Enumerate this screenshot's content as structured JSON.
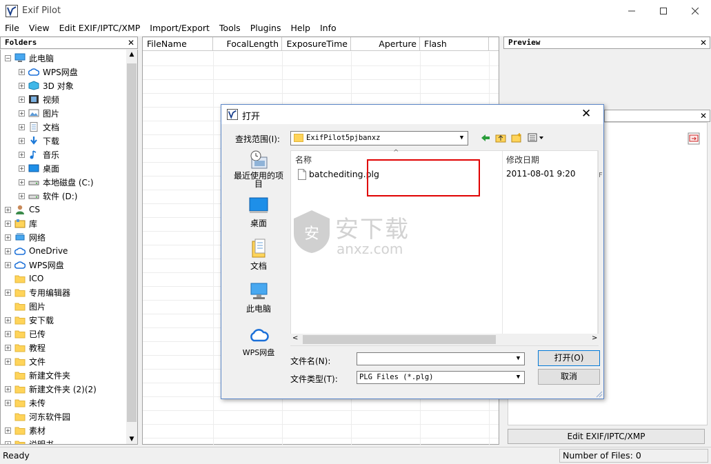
{
  "app": {
    "title": "Exif Pilot"
  },
  "menu": [
    "File",
    "View",
    "Edit EXIF/IPTC/XMP",
    "Import/Export",
    "Tools",
    "Plugins",
    "Help",
    "Info"
  ],
  "folders_pane": {
    "title": "Folders",
    "tree": [
      {
        "label": "此电脑",
        "level": 0,
        "expander": "−",
        "icon": "computer-icon"
      },
      {
        "label": "WPS网盘",
        "level": 1,
        "expander": "+",
        "icon": "cloud-icon"
      },
      {
        "label": "3D 对象",
        "level": 1,
        "expander": "+",
        "icon": "cube-icon"
      },
      {
        "label": "视频",
        "level": 1,
        "expander": "+",
        "icon": "video-icon"
      },
      {
        "label": "图片",
        "level": 1,
        "expander": "+",
        "icon": "picture-icon"
      },
      {
        "label": "文档",
        "level": 1,
        "expander": "+",
        "icon": "document-icon"
      },
      {
        "label": "下载",
        "level": 1,
        "expander": "+",
        "icon": "download-icon"
      },
      {
        "label": "音乐",
        "level": 1,
        "expander": "+",
        "icon": "music-icon"
      },
      {
        "label": "桌面",
        "level": 1,
        "expander": "+",
        "icon": "desktop-icon"
      },
      {
        "label": "本地磁盘 (C:)",
        "level": 1,
        "expander": "+",
        "icon": "drive-icon"
      },
      {
        "label": "软件 (D:)",
        "level": 1,
        "expander": "+",
        "icon": "drive-icon"
      },
      {
        "label": "CS",
        "level": 0,
        "expander": "+",
        "icon": "user-icon"
      },
      {
        "label": "库",
        "level": 0,
        "expander": "+",
        "icon": "library-icon"
      },
      {
        "label": "网络",
        "level": 0,
        "expander": "+",
        "icon": "network-icon"
      },
      {
        "label": "OneDrive",
        "level": 0,
        "expander": "+",
        "icon": "cloud-icon"
      },
      {
        "label": "WPS网盘",
        "level": 0,
        "expander": "+",
        "icon": "cloud-icon"
      },
      {
        "label": "ICO",
        "level": 0,
        "expander": "",
        "icon": "folder-icon"
      },
      {
        "label": "专用编辑器",
        "level": 0,
        "expander": "+",
        "icon": "folder-icon"
      },
      {
        "label": "图片",
        "level": 0,
        "expander": "",
        "icon": "folder-icon"
      },
      {
        "label": "安下载",
        "level": 0,
        "expander": "+",
        "icon": "folder-icon"
      },
      {
        "label": "已传",
        "level": 0,
        "expander": "+",
        "icon": "folder-icon"
      },
      {
        "label": "教程",
        "level": 0,
        "expander": "+",
        "icon": "folder-icon"
      },
      {
        "label": "文件",
        "level": 0,
        "expander": "+",
        "icon": "folder-icon"
      },
      {
        "label": "新建文件夹",
        "level": 0,
        "expander": "",
        "icon": "folder-icon"
      },
      {
        "label": "新建文件夹 (2)(2)",
        "level": 0,
        "expander": "+",
        "icon": "folder-icon"
      },
      {
        "label": "未传",
        "level": 0,
        "expander": "+",
        "icon": "folder-icon"
      },
      {
        "label": "河东软件园",
        "level": 0,
        "expander": "",
        "icon": "folder-icon"
      },
      {
        "label": "素材",
        "level": 0,
        "expander": "+",
        "icon": "folder-icon"
      },
      {
        "label": "说明书",
        "level": 0,
        "expander": "+",
        "icon": "folder-icon"
      }
    ]
  },
  "file_list": {
    "columns": [
      "FileName",
      "FocalLength",
      "ExposureTime",
      "Aperture",
      "Flash"
    ]
  },
  "preview_pane": {
    "title": "Preview"
  },
  "edit_button": "Edit EXIF/IPTC/XMP",
  "status": {
    "left": "Ready",
    "right": "Number of Files: 0"
  },
  "dialog": {
    "title": "打开",
    "lookin_label": "查找范围(I):",
    "lookin_value": "ExifPilot5pjbanxz",
    "places": [
      "最近使用的项目",
      "桌面",
      "文档",
      "此电脑",
      "WPS网盘"
    ],
    "headers": {
      "name": "名称",
      "date": "修改日期"
    },
    "files": [
      {
        "name": "batchediting.plg",
        "date": "2011-08-01 9:20"
      }
    ],
    "filename_label": "文件名(N):",
    "filename_value": "",
    "filetype_label": "文件类型(T):",
    "filetype_value": "PLG Files (*.plg)",
    "open_button": "打开(O)",
    "cancel_button": "取消"
  },
  "watermark": {
    "brand": "安下载",
    "domain": "anxz.com"
  },
  "colors": {
    "highlight_box": "#e00000",
    "selection": "#cce8ff",
    "accent": "#0078d7"
  }
}
